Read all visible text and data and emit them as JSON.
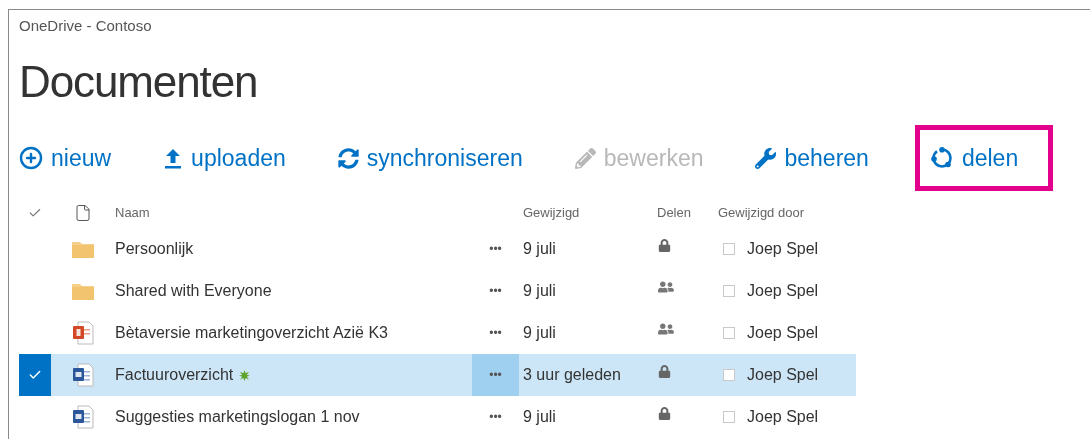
{
  "site_title": "OneDrive - Contoso",
  "page_title": "Documenten",
  "toolbar": [
    {
      "kind": "new",
      "label": "nieuw",
      "disabled": false,
      "highlighted": false
    },
    {
      "kind": "upload",
      "label": "uploaden",
      "disabled": false,
      "highlighted": false
    },
    {
      "kind": "sync",
      "label": "synchroniseren",
      "disabled": false,
      "highlighted": false
    },
    {
      "kind": "edit",
      "label": "bewerken",
      "disabled": true,
      "highlighted": false
    },
    {
      "kind": "manage",
      "label": "beheren",
      "disabled": false,
      "highlighted": false
    },
    {
      "kind": "share",
      "label": "delen",
      "disabled": false,
      "highlighted": true
    }
  ],
  "table": {
    "columns": [
      "Naam",
      "Gewijzigd",
      "Delen",
      "Gewijzigd door"
    ],
    "rows": [
      {
        "kind": "folder",
        "name": "Persoonlijk",
        "new": false,
        "menu": "•••",
        "modified": "9 juli",
        "sharing": {
          "kind": "private"
        },
        "modified_by": "Joep Spel",
        "checked": false,
        "selected": false
      },
      {
        "kind": "folder",
        "name": "Shared with Everyone",
        "new": false,
        "menu": "•••",
        "modified": "9 juli",
        "sharing": {
          "kind": "shared"
        },
        "modified_by": "Joep Spel",
        "checked": false,
        "selected": false
      },
      {
        "kind": "powerpoint",
        "name": "Bètaversie marketingoverzicht Azië K3",
        "new": false,
        "menu": "•••",
        "modified": "9 juli",
        "sharing": {
          "kind": "shared"
        },
        "modified_by": "Joep Spel",
        "checked": false,
        "selected": false
      },
      {
        "kind": "word",
        "name": "Factuuroverzicht",
        "new": true,
        "menu": "•••",
        "modified": "3 uur geleden",
        "sharing": {
          "kind": "private"
        },
        "modified_by": "Joep Spel",
        "checked": false,
        "selected": true
      },
      {
        "kind": "word",
        "name": "Suggesties marketingslogan 1 nov",
        "new": false,
        "menu": "•••",
        "modified": "9 juli",
        "sharing": {
          "kind": "private"
        },
        "modified_by": "Joep Spel",
        "checked": false,
        "selected": false
      }
    ]
  }
}
